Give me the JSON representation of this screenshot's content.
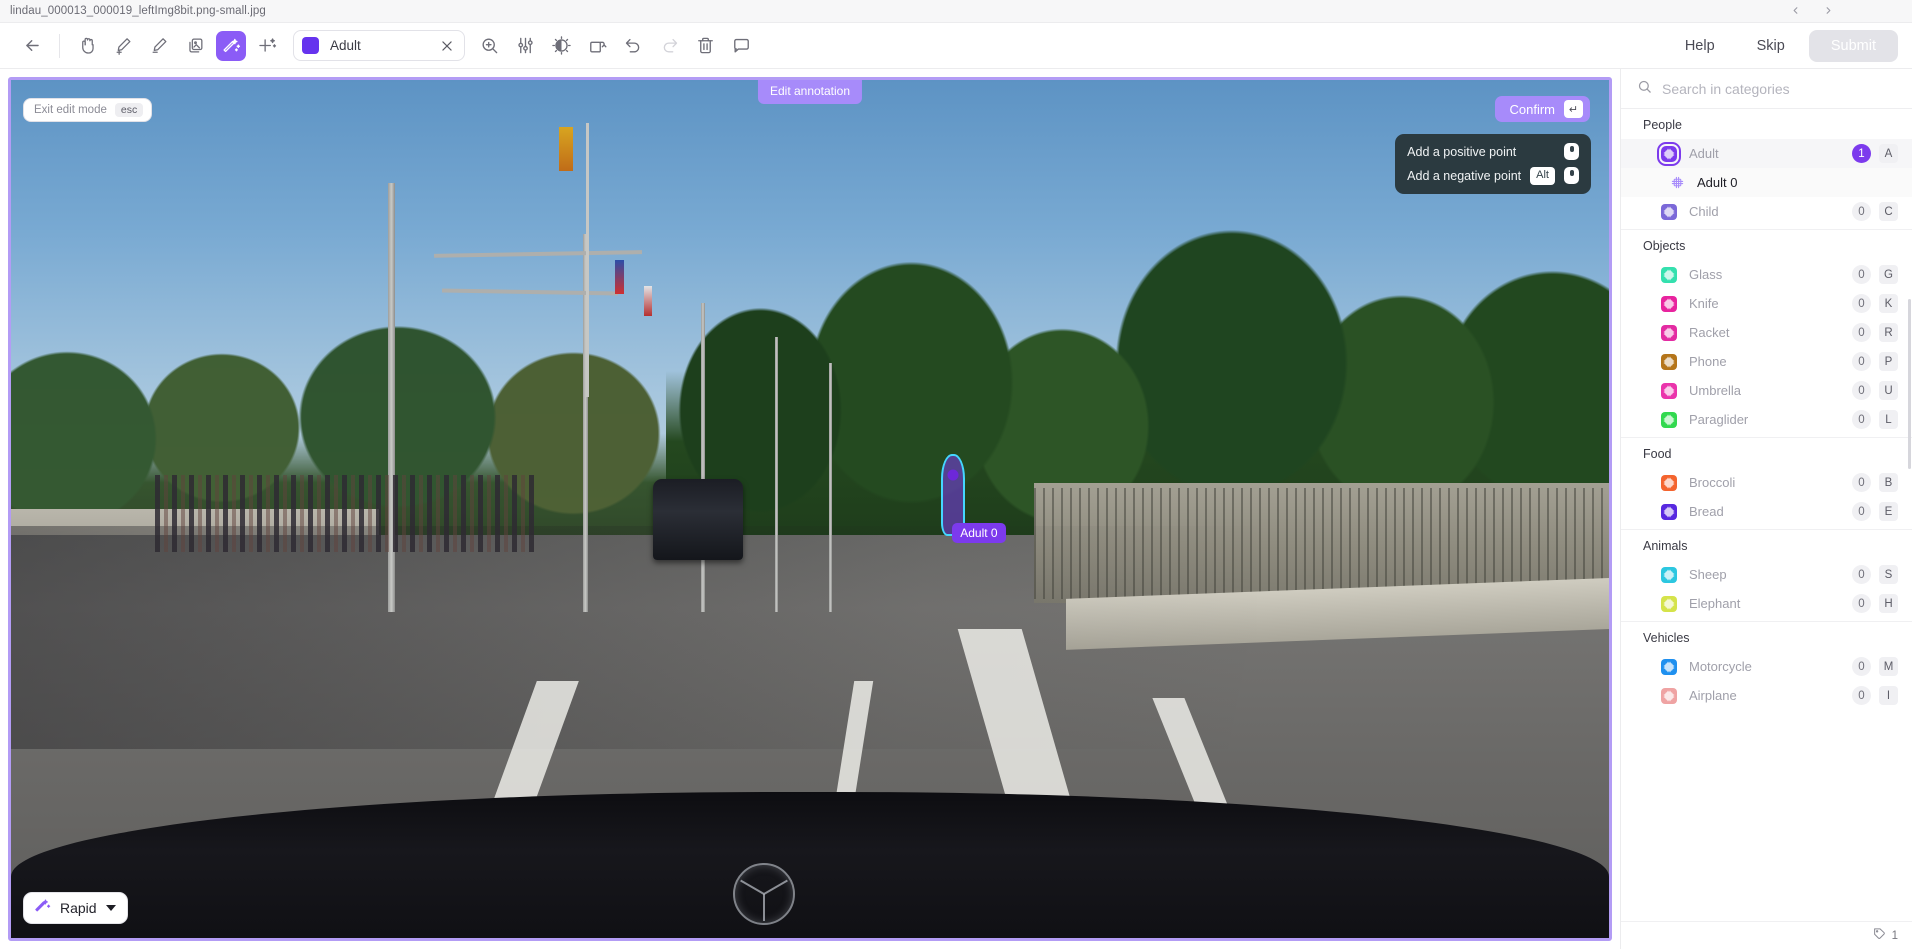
{
  "titlebar": {
    "filename": "lindau_000013_000019_leftImg8bit.png-small.jpg",
    "prev_icon": "chevron-left-icon",
    "next_icon": "chevron-right-icon"
  },
  "toolbar": {
    "back_icon": "arrow-left-icon",
    "tools": [
      {
        "name": "pan-tool",
        "icon": "hand-icon",
        "active": false
      },
      {
        "name": "brush-add-tool",
        "icon": "brush-plus-icon",
        "active": false
      },
      {
        "name": "brush-erase-tool",
        "icon": "brush-minus-icon",
        "active": false
      },
      {
        "name": "copy-layer-tool",
        "icon": "duplicate-icon",
        "active": false
      },
      {
        "name": "magic-wand-tool",
        "icon": "magic-wand-icon",
        "active": true
      },
      {
        "name": "add-point-tool",
        "icon": "sparkle-plus-icon",
        "active": false
      }
    ],
    "category_chip": {
      "color": "#6633ee",
      "label": "Adult",
      "clear_icon": "close-icon"
    },
    "right_tools": [
      {
        "name": "zoom-tool",
        "icon": "zoom-in-icon",
        "disabled": false
      },
      {
        "name": "adjust-sliders",
        "icon": "sliders-icon",
        "disabled": false
      },
      {
        "name": "brightness-tool",
        "icon": "brightness-icon",
        "disabled": false
      },
      {
        "name": "rotate-tool",
        "icon": "rotate-icon",
        "disabled": false
      },
      {
        "name": "undo-button",
        "icon": "undo-icon",
        "disabled": false
      },
      {
        "name": "redo-button",
        "icon": "redo-icon",
        "disabled": true
      },
      {
        "name": "delete-button",
        "icon": "trash-icon",
        "disabled": false
      },
      {
        "name": "comment-button",
        "icon": "comment-icon",
        "disabled": false
      }
    ],
    "help_label": "Help",
    "skip_label": "Skip",
    "submit_label": "Submit"
  },
  "canvas": {
    "exit_edit_label": "Exit edit mode",
    "exit_edit_key": "esc",
    "edit_badge": "Edit annotation",
    "confirm_label": "Confirm",
    "confirm_key": "↵",
    "hints": [
      {
        "text": "Add a positive point",
        "modifier": "",
        "input_icon": "mouse-icon"
      },
      {
        "text": "Add a negative point",
        "modifier": "Alt",
        "input_icon": "mouse-icon"
      }
    ],
    "annotation_label": "Adult 0",
    "mode_button": {
      "label": "Rapid",
      "icon": "magic-wand-icon",
      "caret": "chevron-down-icon"
    }
  },
  "sidebar": {
    "search": {
      "icon": "search-icon",
      "placeholder": "Search in categories",
      "value": ""
    },
    "groups": [
      {
        "name": "People",
        "items": [
          {
            "label": "Adult",
            "color": "#7c3aed",
            "count": "1",
            "key": "A",
            "selected": true,
            "badge_on": true,
            "ringed": true
          },
          {
            "label": "Child",
            "color": "#7b68d8",
            "count": "0",
            "key": "C",
            "selected": false,
            "badge_on": false,
            "ringed": false
          }
        ],
        "instances": [
          {
            "label": "Adult 0",
            "color": "#a78bfa",
            "after": "Adult"
          }
        ]
      },
      {
        "name": "Objects",
        "items": [
          {
            "label": "Glass",
            "color": "#34e0ae",
            "count": "0",
            "key": "G",
            "selected": false,
            "badge_on": false,
            "ringed": false
          },
          {
            "label": "Knife",
            "color": "#e8239e",
            "count": "0",
            "key": "K",
            "selected": false,
            "badge_on": false,
            "ringed": false
          },
          {
            "label": "Racket",
            "color": "#e32ba2",
            "count": "0",
            "key": "R",
            "selected": false,
            "badge_on": false,
            "ringed": false
          },
          {
            "label": "Phone",
            "color": "#b5751a",
            "count": "0",
            "key": "P",
            "selected": false,
            "badge_on": false,
            "ringed": false
          },
          {
            "label": "Umbrella",
            "color": "#ea34ab",
            "count": "0",
            "key": "U",
            "selected": false,
            "badge_on": false,
            "ringed": false
          },
          {
            "label": "Paraglider",
            "color": "#32d94f",
            "count": "0",
            "key": "L",
            "selected": false,
            "badge_on": false,
            "ringed": false
          }
        ],
        "instances": []
      },
      {
        "name": "Food",
        "items": [
          {
            "label": "Broccoli",
            "color": "#f4642e",
            "count": "0",
            "key": "B",
            "selected": false,
            "badge_on": false,
            "ringed": false
          },
          {
            "label": "Bread",
            "color": "#5728e0",
            "count": "0",
            "key": "E",
            "selected": false,
            "badge_on": false,
            "ringed": false
          }
        ],
        "instances": []
      },
      {
        "name": "Animals",
        "items": [
          {
            "label": "Sheep",
            "color": "#2cc7e0",
            "count": "0",
            "key": "S",
            "selected": false,
            "badge_on": false,
            "ringed": false
          },
          {
            "label": "Elephant",
            "color": "#d5e34a",
            "count": "0",
            "key": "H",
            "selected": false,
            "badge_on": false,
            "ringed": false
          }
        ],
        "instances": []
      },
      {
        "name": "Vehicles",
        "items": [
          {
            "label": "Motorcycle",
            "color": "#1f90ef",
            "count": "0",
            "key": "M",
            "selected": false,
            "badge_on": false,
            "ringed": false
          },
          {
            "label": "Airplane",
            "color": "#efa3a3",
            "count": "0",
            "key": "I",
            "selected": false,
            "badge_on": false,
            "ringed": false
          }
        ],
        "instances": []
      }
    ],
    "footer": {
      "icon": "tag-icon",
      "count": "1"
    }
  }
}
